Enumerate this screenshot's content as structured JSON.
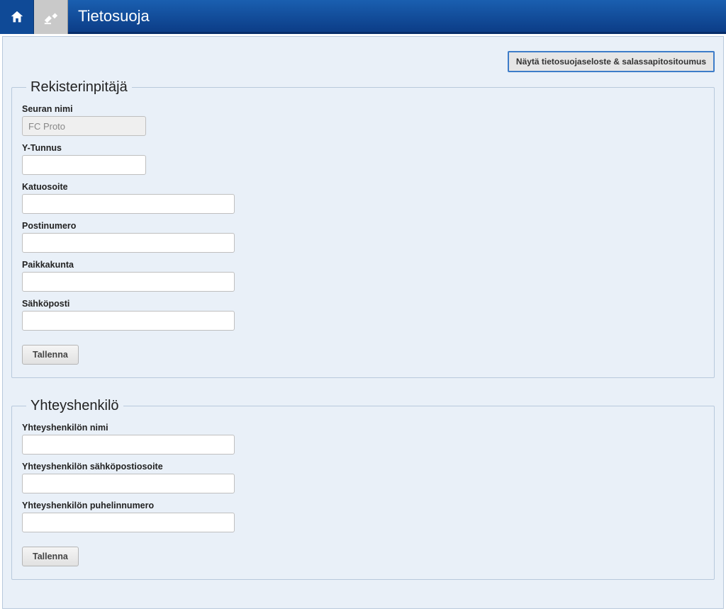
{
  "header": {
    "title": "Tietosuoja"
  },
  "actions": {
    "show_privacy_label": "Näytä tietosuojaseloste & salassapitositoumus"
  },
  "section_registrar": {
    "legend": "Rekisterinpitäjä",
    "fields": {
      "club_name": {
        "label": "Seuran nimi",
        "value": "FC Proto"
      },
      "y_tunnus": {
        "label": "Y-Tunnus",
        "value": ""
      },
      "street": {
        "label": "Katuosoite",
        "value": ""
      },
      "postal": {
        "label": "Postinumero",
        "value": ""
      },
      "city": {
        "label": "Paikkakunta",
        "value": ""
      },
      "email": {
        "label": "Sähköposti",
        "value": ""
      }
    },
    "save_label": "Tallenna"
  },
  "section_contact": {
    "legend": "Yhteyshenkilö",
    "fields": {
      "name": {
        "label": "Yhteyshenkilön nimi",
        "value": ""
      },
      "email": {
        "label": "Yhteyshenkilön sähköpostiosoite",
        "value": ""
      },
      "phone": {
        "label": "Yhteyshenkilön puhelinnumero",
        "value": ""
      }
    },
    "save_label": "Tallenna"
  }
}
